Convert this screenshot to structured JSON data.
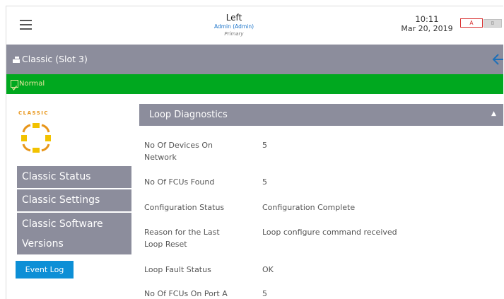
{
  "header": {
    "title": "Left",
    "user": "Admin (Admin)",
    "role": "Primary",
    "time": "10:11",
    "date": "Mar 20, 2019",
    "slot_a_label": "A",
    "slot_b_label": "B"
  },
  "titlebar": {
    "title": "Classic (Slot 3)",
    "back_icon": "arrow-left-icon"
  },
  "status": {
    "label": "Normal",
    "color": "#00a81f"
  },
  "logo": {
    "text": "CLASSIC"
  },
  "nav": {
    "items": [
      {
        "label": "Classic Status"
      },
      {
        "label": "Classic Settings"
      },
      {
        "label_line1": "Classic Software",
        "label_line2": "Versions"
      }
    ],
    "event_log_label": "Event Log"
  },
  "panel": {
    "title": "Loop Diagnostics",
    "rows": [
      {
        "label_line1": "No Of Devices On",
        "label_line2": "Network",
        "value": "5"
      },
      {
        "label": "No Of FCUs Found",
        "value": "5"
      },
      {
        "label": "Configuration Status",
        "value": "Configuration Complete"
      },
      {
        "label_line1": "Reason for the Last",
        "label_line2": "Loop Reset",
        "value": "Loop configure command received"
      },
      {
        "label": "Loop Fault Status",
        "value": "OK"
      },
      {
        "label": "No Of FCUs On Port A",
        "value": "5"
      }
    ]
  },
  "colors": {
    "accent_gray": "#8c8d9c",
    "status_green": "#00a81f",
    "button_blue": "#0d8fd6",
    "logo_orange": "#e8961a",
    "logo_yellow": "#f2c200"
  }
}
